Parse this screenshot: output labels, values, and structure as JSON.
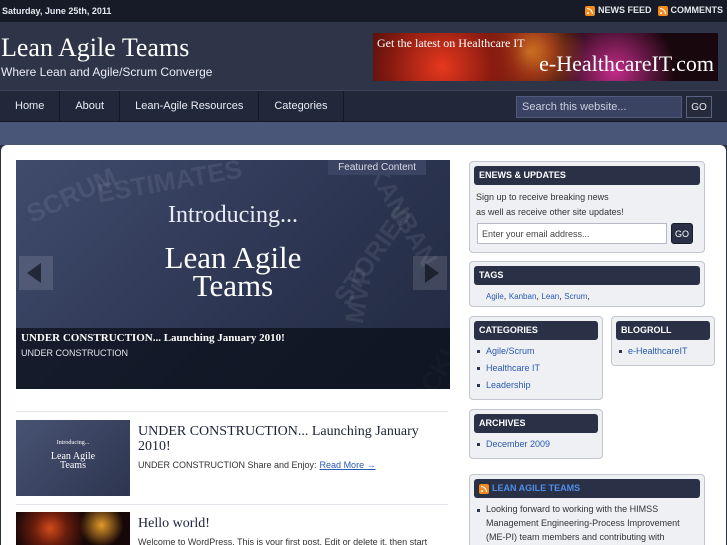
{
  "topbar": {
    "date": "Saturday, June 25th, 2011",
    "news_feed": "NEWS FEED",
    "comments": "COMMENTS"
  },
  "header": {
    "title": "Lean Agile Teams",
    "description": "Where Lean and Agile/Scrum Converge",
    "banner_line1": "Get the latest on Healthcare IT",
    "banner_line2": "e-HealthcareIT.com"
  },
  "nav": {
    "items": [
      "Home",
      "About",
      "Lean-Agile Resources",
      "Categories"
    ],
    "search_placeholder": "Search this website...",
    "go_label": "GO"
  },
  "featured": {
    "tag": "Featured Content",
    "intro": "Introducing...",
    "big_line1": "Lean Agile",
    "big_line2": "Teams",
    "caption_title": "UNDER CONSTRUCTION... Launching January 2010!",
    "caption_sub": "UNDER CONSTRUCTION",
    "watermarks": [
      "SCRUM",
      "ESTIMATES",
      "KANBAN",
      "STORIES",
      "MVP",
      "BACKLOG"
    ]
  },
  "posts": [
    {
      "title": "UNDER CONSTRUCTION... Launching January 2010!",
      "excerpt": "UNDER CONSTRUCTION Share and Enjoy:",
      "read_more": "Read More →",
      "thumb_intro": "Introducing...",
      "thumb_line1": "Lean Agile",
      "thumb_line2": "Teams"
    },
    {
      "title": "Hello world!",
      "excerpt": "Welcome to WordPress. This is your first post. Edit or delete it, then start"
    }
  ],
  "sidebar": {
    "enews": {
      "title": "ENEWS & UPDATES",
      "line1": "Sign up to receive breaking news",
      "line2": "as well as receive other site updates!",
      "email_placeholder": "Enter your email address...",
      "go_label": "GO"
    },
    "tags": {
      "title": "TAGS",
      "items": [
        "Agile",
        "Kanban",
        "Lean",
        "Scrum"
      ]
    },
    "categories": {
      "title": "CATEGORIES",
      "items": [
        "Agile/Scrum",
        "Healthcare IT",
        "Leadership"
      ]
    },
    "blogroll": {
      "title": "BLOGROLL",
      "items": [
        "e-HealthcareIT"
      ]
    },
    "archives": {
      "title": "ARCHIVES",
      "items": [
        "December 2009"
      ]
    },
    "lat": {
      "title": "LEAN AGILE TEAMS",
      "text": "Looking forward to working with the HIMSS Management Engineering-Process Improvement (ME-PI) team members and contributing with"
    }
  }
}
